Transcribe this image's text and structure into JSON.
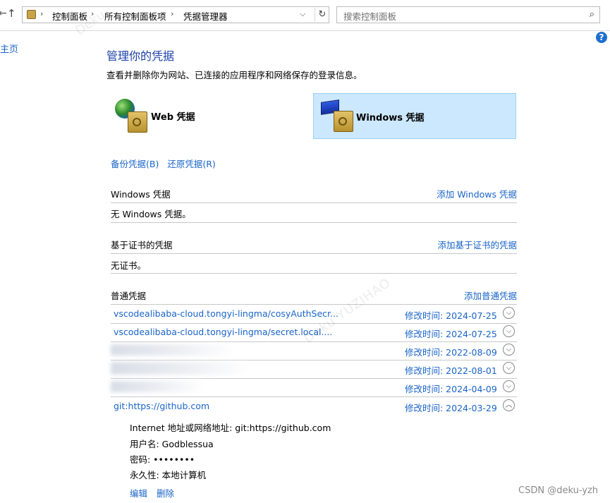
{
  "address_bar": {
    "breadcrumbs": [
      "控制面板",
      "所有控制面板项",
      "凭据管理器"
    ],
    "search_placeholder": "搜索控制面板"
  },
  "sidebar": {
    "home_label": "主页"
  },
  "main": {
    "title": "管理你的凭据",
    "subtitle": "查看并删除你为网站、已连接的应用程序和网络保存的登录信息。",
    "tiles": [
      {
        "label": "Web 凭据",
        "icon": "web-credential-icon",
        "selected": false
      },
      {
        "label": "Windows 凭据",
        "icon": "windows-credential-icon",
        "selected": true
      }
    ],
    "backup_label": "备份凭据(B)",
    "restore_label": "还原凭据(R)"
  },
  "sections": {
    "windows": {
      "title": "Windows 凭据",
      "add_link": "添加 Windows 凭据",
      "empty_text": "无 Windows 凭据。"
    },
    "cert": {
      "title": "基于证书的凭据",
      "add_link": "添加基于证书的凭据",
      "empty_text": "无证书。"
    },
    "generic": {
      "title": "普通凭据",
      "add_link": "添加普通凭据"
    }
  },
  "generic_credentials": [
    {
      "name": "vscodealibaba-cloud.tongyi-lingma/cosyAuthSecr...",
      "modified": "修改时间:  2024-07-25",
      "expanded": false
    },
    {
      "name": "vscodealibaba-cloud.tongyi-lingma/secret.local....",
      "modified": "修改时间:  2024-07-25",
      "expanded": false
    },
    {
      "name": "",
      "modified": "修改时间:  2022-08-09",
      "expanded": false
    },
    {
      "name": "",
      "modified": "修改时间:  2022-08-01",
      "expanded": false
    },
    {
      "name": "",
      "modified": "修改时间:  2024-04-09",
      "expanded": false
    },
    {
      "name": "git:https://github.com",
      "modified": "修改时间:  2024-03-29",
      "expanded": true
    }
  ],
  "expanded_detail": {
    "address": "Internet 地址或网络地址:  git:https://github.com",
    "username": "用户名:  Godblessua",
    "password": "密码:  ••••••••",
    "persistence": "永久性:  本地计算机",
    "edit_label": "编辑",
    "delete_label": "删除"
  },
  "watermarks": {
    "csdn": "CSDN @deku-yzh",
    "diagonal": "Deku YUZIHAO",
    "diagonal_top": "Deku"
  },
  "colors": {
    "link": "#1a64c8",
    "title": "#1a3fa8",
    "selected_tile": "#cce8ff"
  }
}
